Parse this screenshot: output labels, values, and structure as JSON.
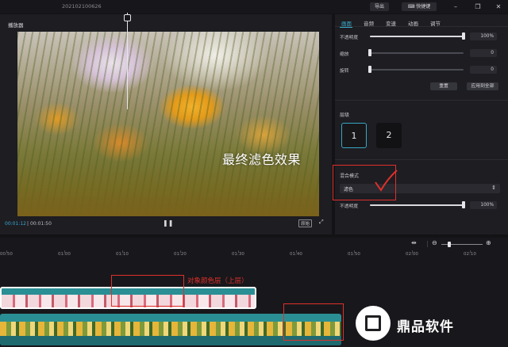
{
  "topbar": {
    "project_name": "202102100626",
    "export_label": "导出",
    "shortcut_label": "快捷键"
  },
  "player": {
    "title": "播放器",
    "caption": "最终滤色效果",
    "current_time": "00:01:12",
    "total_time": "00:01:50",
    "original_label": "原始"
  },
  "props": {
    "tabs": [
      "画面",
      "音频",
      "变速",
      "动画",
      "调节"
    ],
    "active_tab": "画面",
    "rows": [
      {
        "label": "不透明度",
        "value": "100%",
        "level": 1.0
      },
      {
        "label": "缩放",
        "value": "0",
        "level": 0.0
      },
      {
        "label": "旋转",
        "value": "0",
        "level": 0.0
      }
    ],
    "reset_label": "重置",
    "apply_all_label": "应用到全部",
    "layer_label": "层级",
    "layers": [
      "1",
      "2"
    ],
    "selected_layer": "1",
    "blend_label": "混合模式",
    "blend_value": "滤色",
    "opacity2_label": "不透明度",
    "opacity2_value": "100%",
    "opacity2_level": 1.0
  },
  "timeline": {
    "ticks": [
      "00:50",
      "01:00",
      "01:10",
      "01:20",
      "01:30",
      "01:40",
      "01:50",
      "02:00",
      "02:10"
    ],
    "zoom_level": 0.2
  },
  "annotations": {
    "top_layer_note": "对象颜色层（上层）"
  },
  "watermark": {
    "brand": "鼎品软件"
  },
  "colors": {
    "accent": "#3bb0cf",
    "annotation": "#e0302a",
    "clip_teal": "#2a8f94"
  }
}
